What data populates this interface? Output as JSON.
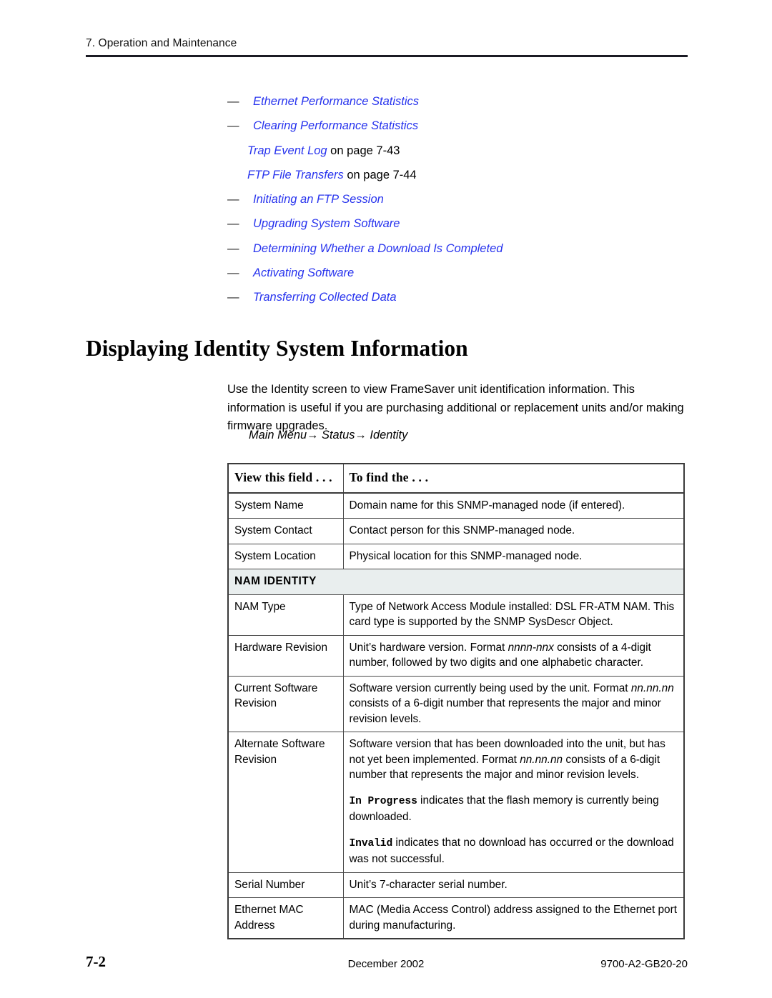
{
  "header": {
    "running_head": "7. Operation and Maintenance"
  },
  "xref_list": [
    {
      "dash": true,
      "link": "Ethernet Performance Statistics",
      "tail": ""
    },
    {
      "dash": true,
      "link": "Clearing Performance Statistics",
      "tail": ""
    },
    {
      "dash": false,
      "link": "Trap Event Log",
      "tail": " on page 7-43"
    },
    {
      "dash": false,
      "link": "FTP File Transfers",
      "tail": " on page 7-44"
    },
    {
      "dash": true,
      "link": "Initiating an FTP Session",
      "tail": ""
    },
    {
      "dash": true,
      "link": "Upgrading System Software",
      "tail": ""
    },
    {
      "dash": true,
      "link": "Determining Whether a Download Is Completed",
      "tail": ""
    },
    {
      "dash": true,
      "link": "Activating Software",
      "tail": ""
    },
    {
      "dash": true,
      "link": "Transferring Collected Data",
      "tail": ""
    }
  ],
  "dash_glyph": "—",
  "section": {
    "heading": "Displaying Identity System Information",
    "paragraph": "Use the Identity screen to view FrameSaver unit identification information. This information is useful if you are purchasing additional or replacement units and/or making firmware upgrades.",
    "menu_path": "Main Menu→ Status→ Identity"
  },
  "table": {
    "columns": [
      "View this field . . .",
      "To find the . . ."
    ],
    "rows": [
      {
        "type": "data",
        "field": "System Name",
        "desc_parts": [
          {
            "t": "Domain name for this SNMP-managed node (if entered).",
            "s": "n"
          }
        ]
      },
      {
        "type": "data",
        "field": "System Contact",
        "desc_parts": [
          {
            "t": "Contact person for this SNMP-managed node.",
            "s": "n"
          }
        ]
      },
      {
        "type": "data",
        "field": "System Location",
        "desc_parts": [
          {
            "t": "Physical location for this SNMP-managed node.",
            "s": "n"
          }
        ]
      },
      {
        "type": "group",
        "label": "NAM IDENTITY"
      },
      {
        "type": "data",
        "field": "NAM Type",
        "desc_parts": [
          {
            "t": "Type of Network Access Module installed: DSL FR-ATM NAM. This card type is supported by the SNMP SysDescr Object.",
            "s": "n"
          }
        ]
      },
      {
        "type": "data",
        "field": "Hardware Revision",
        "desc_parts": [
          {
            "t": "Unit’s hardware version. Format ",
            "s": "n"
          },
          {
            "t": "nnnn-nnx",
            "s": "i"
          },
          {
            "t": " consists of a 4-digit number, followed by two digits and one alphabetic character.",
            "s": "n"
          }
        ]
      },
      {
        "type": "data",
        "field": "Current Software Revision",
        "desc_parts": [
          {
            "t": "Software version currently being used by the unit. Format ",
            "s": "n"
          },
          {
            "t": "nn.nn.nn",
            "s": "i"
          },
          {
            "t": " consists of a 6-digit number that represents the major and minor revision levels.",
            "s": "n"
          }
        ]
      },
      {
        "type": "data",
        "field": "Alternate Software Revision",
        "desc_parts": [
          {
            "t": "Software version that has been downloaded into the unit, but has not yet been implemented. Format ",
            "s": "n"
          },
          {
            "t": "nn.nn.nn",
            "s": "i"
          },
          {
            "t": " consists of a 6-digit number that represents the major and minor revision levels.",
            "s": "n"
          }
        ],
        "notes": [
          [
            {
              "t": "In Progress",
              "s": "m"
            },
            {
              "t": " indicates that the flash memory is currently being downloaded.",
              "s": "n"
            }
          ],
          [
            {
              "t": "Invalid",
              "s": "m"
            },
            {
              "t": " indicates that no download has occurred or the download was not successful.",
              "s": "n"
            }
          ]
        ]
      },
      {
        "type": "data",
        "field": "Serial Number",
        "desc_parts": [
          {
            "t": "Unit’s 7-character serial number.",
            "s": "n"
          }
        ]
      },
      {
        "type": "data",
        "field": "Ethernet MAC Address",
        "desc_parts": [
          {
            "t": "MAC (Media Access Control) address assigned to the Ethernet port during manufacturing.",
            "s": "n"
          }
        ]
      }
    ]
  },
  "footer": {
    "page_number": "7-2",
    "date": "December 2002",
    "doc_number": "9700-A2-GB20-20"
  },
  "colors": {
    "link": "#2733ee",
    "group_row_bg": "#e9eeee",
    "rule": "#1b1b24"
  }
}
